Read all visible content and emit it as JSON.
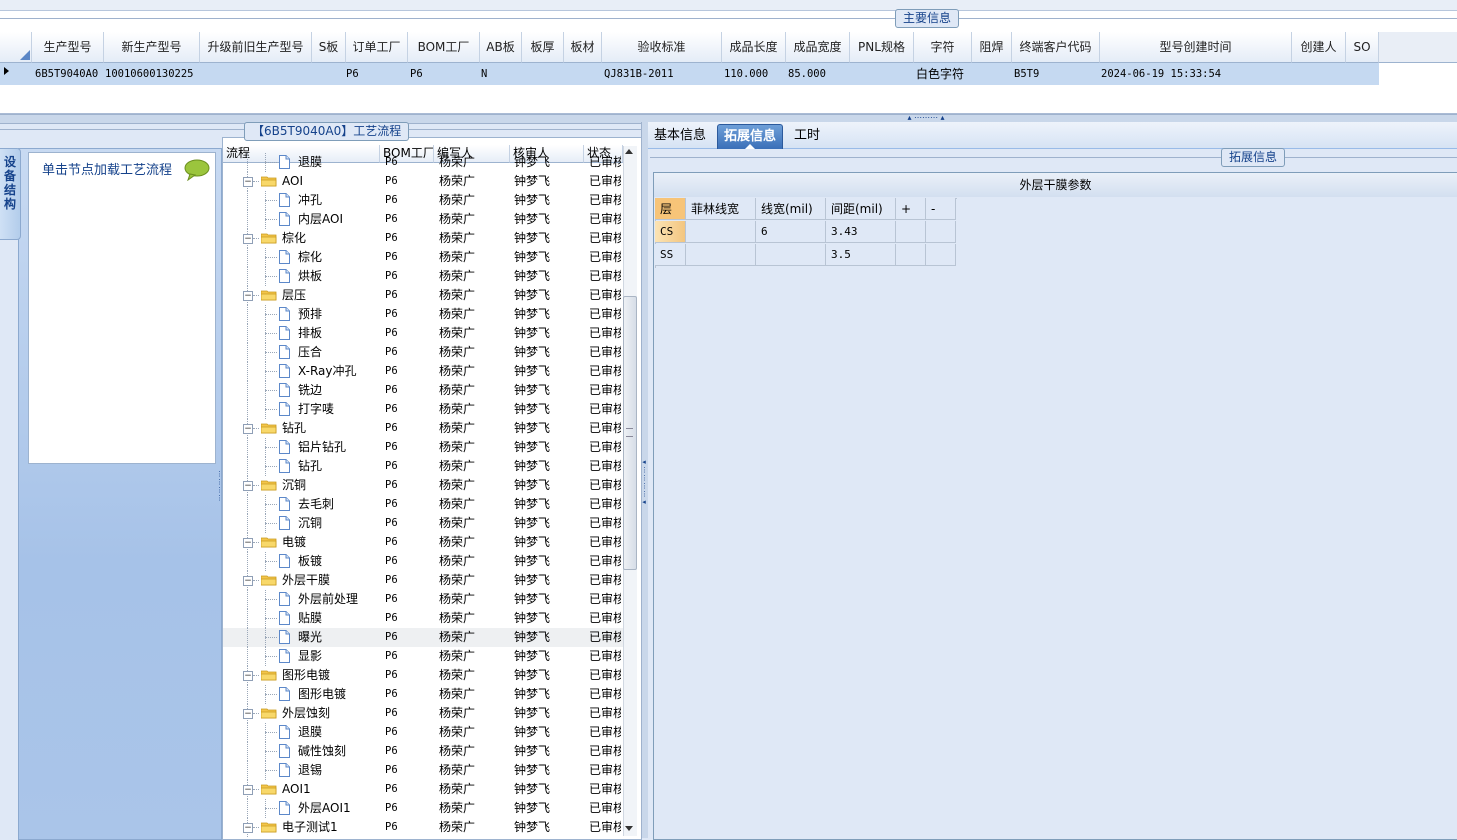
{
  "main_info": {
    "legend": "主要信息",
    "columns": [
      "生产型号",
      "新生产型号",
      "升级前旧生产型号",
      "S板",
      "订单工厂",
      "BOM工厂",
      "AB板",
      "板厚",
      "板材",
      "验收标准",
      "成品长度",
      "成品宽度",
      "PNL规格",
      "字符",
      "阻焊",
      "终端客户代码",
      "型号创建时间",
      "创建人",
      "SO"
    ],
    "row": {
      "prod_model": "6B5T9040A0",
      "new_prod_model": "10010600130225",
      "old_model": "",
      "s_board": "",
      "order_factory": "P6",
      "bom_factory": "P6",
      "ab_board": "N",
      "thickness": "",
      "material": "",
      "standard": "QJ831B-2011",
      "length": "110.000",
      "width": "85.000",
      "pnl": "",
      "char": "白色字符",
      "solder": "",
      "customer_code": "B5T9",
      "created": "2024-06-19 15:33:54",
      "creator": "",
      "so": ""
    }
  },
  "left_panel": {
    "vertical_tab": "设备结构",
    "hint": "单击节点加载工艺流程"
  },
  "flow": {
    "legend": "【6B5T9040A0】工艺流程",
    "columns": [
      "流程",
      "BOM工厂",
      "编写人",
      "核审人",
      "状态"
    ],
    "rows": [
      {
        "name": "退膜",
        "level": 2,
        "factory": "P6",
        "writer": "杨荣广",
        "reviewer": "钟梦飞",
        "status": "已审核"
      },
      {
        "name": "AOI",
        "level": 1,
        "factory": "P6",
        "writer": "杨荣广",
        "reviewer": "钟梦飞",
        "status": "已审核"
      },
      {
        "name": "冲孔",
        "level": 2,
        "factory": "P6",
        "writer": "杨荣广",
        "reviewer": "钟梦飞",
        "status": "已审核"
      },
      {
        "name": "内层AOI",
        "level": 2,
        "factory": "P6",
        "writer": "杨荣广",
        "reviewer": "钟梦飞",
        "status": "已审核"
      },
      {
        "name": "棕化",
        "level": 1,
        "factory": "P6",
        "writer": "杨荣广",
        "reviewer": "钟梦飞",
        "status": "已审核"
      },
      {
        "name": "棕化",
        "level": 2,
        "factory": "P6",
        "writer": "杨荣广",
        "reviewer": "钟梦飞",
        "status": "已审核"
      },
      {
        "name": "烘板",
        "level": 2,
        "factory": "P6",
        "writer": "杨荣广",
        "reviewer": "钟梦飞",
        "status": "已审核"
      },
      {
        "name": "层压",
        "level": 1,
        "factory": "P6",
        "writer": "杨荣广",
        "reviewer": "钟梦飞",
        "status": "已审核"
      },
      {
        "name": "预排",
        "level": 2,
        "factory": "P6",
        "writer": "杨荣广",
        "reviewer": "钟梦飞",
        "status": "已审核"
      },
      {
        "name": "排板",
        "level": 2,
        "factory": "P6",
        "writer": "杨荣广",
        "reviewer": "钟梦飞",
        "status": "已审核"
      },
      {
        "name": "压合",
        "level": 2,
        "factory": "P6",
        "writer": "杨荣广",
        "reviewer": "钟梦飞",
        "status": "已审核"
      },
      {
        "name": "X-Ray冲孔",
        "level": 2,
        "factory": "P6",
        "writer": "杨荣广",
        "reviewer": "钟梦飞",
        "status": "已审核"
      },
      {
        "name": "铣边",
        "level": 2,
        "factory": "P6",
        "writer": "杨荣广",
        "reviewer": "钟梦飞",
        "status": "已审核"
      },
      {
        "name": "打字唛",
        "level": 2,
        "factory": "P6",
        "writer": "杨荣广",
        "reviewer": "钟梦飞",
        "status": "已审核"
      },
      {
        "name": "钻孔",
        "level": 1,
        "factory": "P6",
        "writer": "杨荣广",
        "reviewer": "钟梦飞",
        "status": "已审核"
      },
      {
        "name": "铝片钻孔",
        "level": 2,
        "factory": "P6",
        "writer": "杨荣广",
        "reviewer": "钟梦飞",
        "status": "已审核"
      },
      {
        "name": "钻孔",
        "level": 2,
        "factory": "P6",
        "writer": "杨荣广",
        "reviewer": "钟梦飞",
        "status": "已审核"
      },
      {
        "name": "沉铜",
        "level": 1,
        "factory": "P6",
        "writer": "杨荣广",
        "reviewer": "钟梦飞",
        "status": "已审核"
      },
      {
        "name": "去毛刺",
        "level": 2,
        "factory": "P6",
        "writer": "杨荣广",
        "reviewer": "钟梦飞",
        "status": "已审核"
      },
      {
        "name": "沉铜",
        "level": 2,
        "factory": "P6",
        "writer": "杨荣广",
        "reviewer": "钟梦飞",
        "status": "已审核"
      },
      {
        "name": "电镀",
        "level": 1,
        "factory": "P6",
        "writer": "杨荣广",
        "reviewer": "钟梦飞",
        "status": "已审核"
      },
      {
        "name": "板镀",
        "level": 2,
        "factory": "P6",
        "writer": "杨荣广",
        "reviewer": "钟梦飞",
        "status": "已审核"
      },
      {
        "name": "外层干膜",
        "level": 1,
        "factory": "P6",
        "writer": "杨荣广",
        "reviewer": "钟梦飞",
        "status": "已审核"
      },
      {
        "name": "外层前处理",
        "level": 2,
        "factory": "P6",
        "writer": "杨荣广",
        "reviewer": "钟梦飞",
        "status": "已审核"
      },
      {
        "name": "贴膜",
        "level": 2,
        "factory": "P6",
        "writer": "杨荣广",
        "reviewer": "钟梦飞",
        "status": "已审核"
      },
      {
        "name": "曝光",
        "level": 2,
        "factory": "P6",
        "writer": "杨荣广",
        "reviewer": "钟梦飞",
        "status": "已审核",
        "highlight": true
      },
      {
        "name": "显影",
        "level": 2,
        "factory": "P6",
        "writer": "杨荣广",
        "reviewer": "钟梦飞",
        "status": "已审核"
      },
      {
        "name": "图形电镀",
        "level": 1,
        "factory": "P6",
        "writer": "杨荣广",
        "reviewer": "钟梦飞",
        "status": "已审核"
      },
      {
        "name": "图形电镀",
        "level": 2,
        "factory": "P6",
        "writer": "杨荣广",
        "reviewer": "钟梦飞",
        "status": "已审核"
      },
      {
        "name": "外层蚀刻",
        "level": 1,
        "factory": "P6",
        "writer": "杨荣广",
        "reviewer": "钟梦飞",
        "status": "已审核"
      },
      {
        "name": "退膜",
        "level": 2,
        "factory": "P6",
        "writer": "杨荣广",
        "reviewer": "钟梦飞",
        "status": "已审核"
      },
      {
        "name": "碱性蚀刻",
        "level": 2,
        "factory": "P6",
        "writer": "杨荣广",
        "reviewer": "钟梦飞",
        "status": "已审核"
      },
      {
        "name": "退锡",
        "level": 2,
        "factory": "P6",
        "writer": "杨荣广",
        "reviewer": "钟梦飞",
        "status": "已审核"
      },
      {
        "name": "AOI1",
        "level": 1,
        "factory": "P6",
        "writer": "杨荣广",
        "reviewer": "钟梦飞",
        "status": "已审核"
      },
      {
        "name": "外层AOI1",
        "level": 2,
        "factory": "P6",
        "writer": "杨荣广",
        "reviewer": "钟梦飞",
        "status": "已审核"
      },
      {
        "name": "电子测试1",
        "level": 1,
        "factory": "P6",
        "writer": "杨荣广",
        "reviewer": "钟梦飞",
        "status": "已审核"
      }
    ]
  },
  "right_panel": {
    "tabs": [
      {
        "label": "基本信息",
        "active": false
      },
      {
        "label": "拓展信息",
        "active": true
      },
      {
        "label": "工时",
        "active": false
      }
    ],
    "legend": "拓展信息",
    "section_title": "外层干膜参数",
    "param_columns": [
      "层",
      "菲林线宽",
      "线宽(mil)",
      "间距(mil)",
      "+",
      "-"
    ],
    "param_rows": [
      {
        "layer": "CS",
        "film_width": "",
        "line_width": "6",
        "spacing": "3.43"
      },
      {
        "layer": "SS",
        "film_width": "",
        "line_width": "",
        "spacing": "3.5"
      }
    ]
  },
  "colors": {
    "selected_row": "#c5d9f1",
    "panel_bg": "#dfe8f6",
    "active_tab": "#3a6fb8",
    "legend_text": "#15428b"
  }
}
